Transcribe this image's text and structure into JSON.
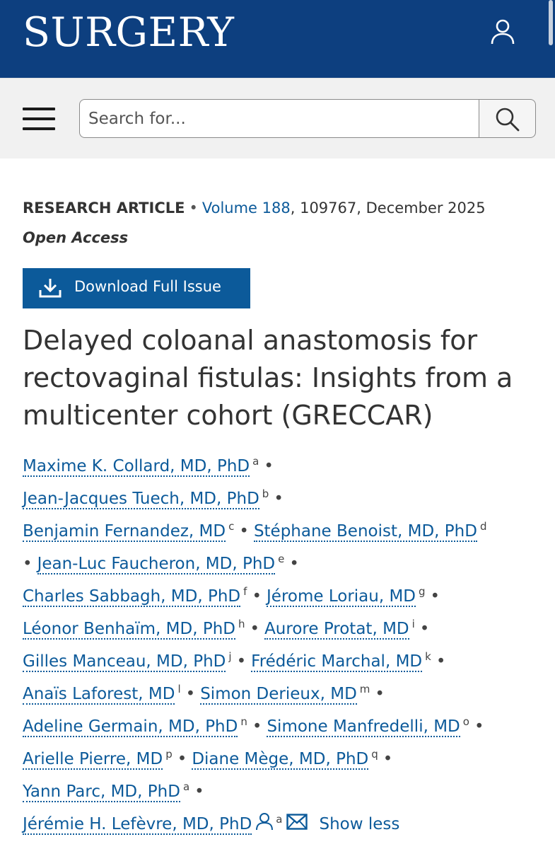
{
  "header": {
    "brand": "SURGERY",
    "user_icon": "user-icon",
    "background_color": "#0d3f7f"
  },
  "search": {
    "placeholder": "Search for...",
    "menu_icon": "hamburger-menu-icon",
    "search_icon": "search-icon"
  },
  "article": {
    "type": "RESEARCH ARTICLE",
    "volume_link": "Volume 188",
    "citation": ", 109767, December 2025",
    "access": "Open Access",
    "download_label": "Download Full Issue",
    "download_icon": "download-icon",
    "title": "Delayed coloanal anastomosis for rectovaginal fistulas: Insights from a multicenter cohort (GRECCAR)"
  },
  "authors": [
    {
      "name": "Maxime K. Collard, MD, PhD",
      "aff": "a"
    },
    {
      "name": "Jean-Jacques Tuech, MD, PhD",
      "aff": "b"
    },
    {
      "name": "Benjamin Fernandez, MD",
      "aff": "c"
    },
    {
      "name": "Stéphane Benoist, MD, PhD",
      "aff": "d"
    },
    {
      "name": "Jean-Luc Faucheron, MD, PhD",
      "aff": "e"
    },
    {
      "name": "Charles Sabbagh, MD, PhD",
      "aff": "f"
    },
    {
      "name": "Jérome Loriau, MD",
      "aff": "g"
    },
    {
      "name": "Léonor Benhaïm, MD, PhD",
      "aff": "h"
    },
    {
      "name": "Aurore Protat, MD",
      "aff": "i"
    },
    {
      "name": "Gilles Manceau, MD, PhD",
      "aff": "j"
    },
    {
      "name": "Frédéric Marchal, MD",
      "aff": "k"
    },
    {
      "name": "Anaïs Laforest, MD",
      "aff": "l"
    },
    {
      "name": "Simon Derieux, MD",
      "aff": "m"
    },
    {
      "name": "Adeline Germain, MD, PhD",
      "aff": "n"
    },
    {
      "name": "Simone Manfredelli, MD",
      "aff": "o"
    },
    {
      "name": "Arielle Pierre, MD",
      "aff": "p"
    },
    {
      "name": "Diane Mège, MD, PhD",
      "aff": "q"
    },
    {
      "name": "Yann Parc, MD, PhD",
      "aff": "a"
    },
    {
      "name": "Jérémie H. Lefèvre, MD, PhD",
      "aff": "a"
    }
  ],
  "separator": "•",
  "corresponding_icon": "person-icon",
  "email_icon": "envelope-icon",
  "show_less": "Show less",
  "colors": {
    "link": "#0c5a9a",
    "text": "#333333",
    "button": "#0c5a9a"
  }
}
